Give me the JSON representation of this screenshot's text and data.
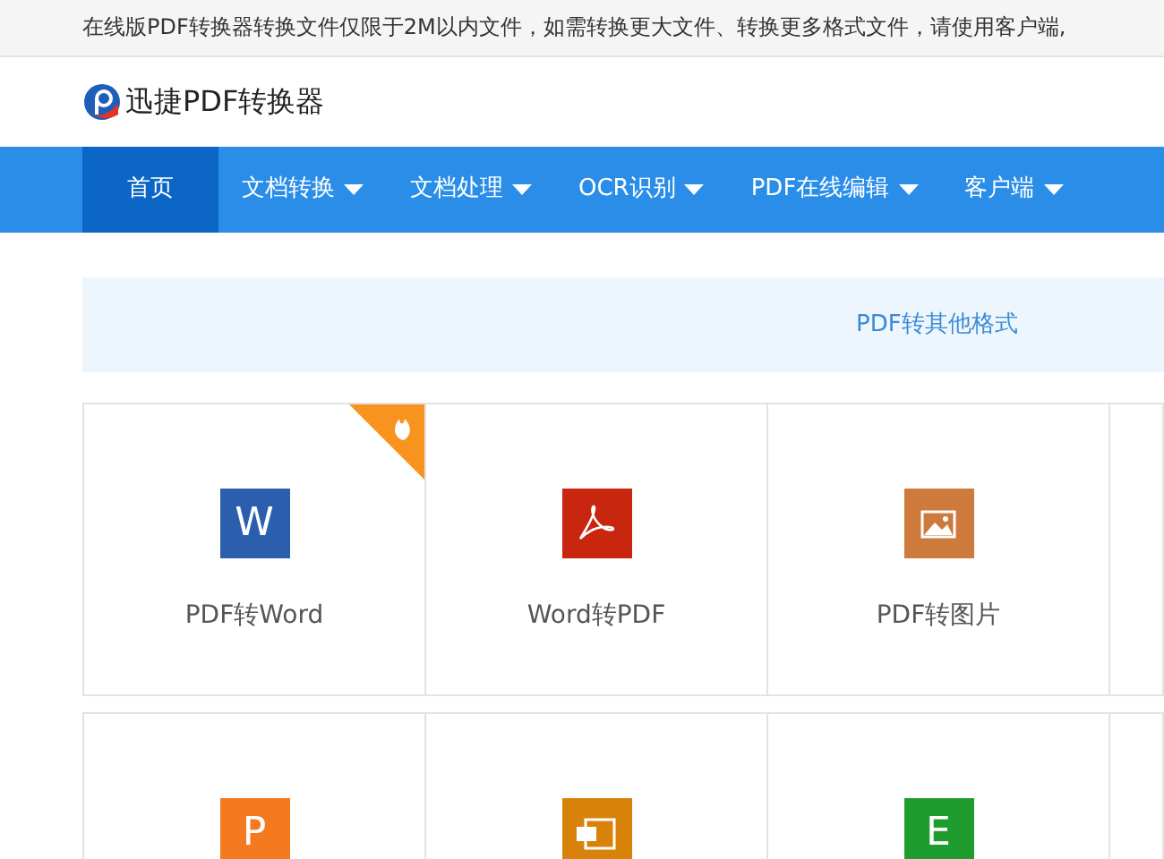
{
  "notice": "在线版PDF转换器转换文件仅限于2M以内文件，如需转换更大文件、转换更多格式文件，请使用客户端,",
  "logo": {
    "text": "迅捷PDF转换器"
  },
  "nav": [
    {
      "label": "首页",
      "selected": true,
      "dropdown": false
    },
    {
      "label": "文档转换",
      "selected": false,
      "dropdown": true
    },
    {
      "label": "文档处理",
      "selected": false,
      "dropdown": true
    },
    {
      "label": "OCR识别",
      "selected": false,
      "dropdown": true
    },
    {
      "label": "PDF在线编辑",
      "selected": false,
      "dropdown": true
    },
    {
      "label": "客户端",
      "selected": false,
      "dropdown": true
    }
  ],
  "section_title": "PDF转其他格式",
  "cards": [
    {
      "kind": "letter",
      "glyph": "W",
      "color": "#2b5fae",
      "label": "PDF转Word",
      "hot": true
    },
    {
      "kind": "acrobat",
      "color": "#c9260f",
      "label": "Word转PDF",
      "hot": false
    },
    {
      "kind": "image",
      "color": "#cd7a3c",
      "label": "PDF转图片",
      "hot": false
    },
    {
      "kind": "empty",
      "hot": false
    },
    {
      "kind": "letter",
      "glyph": "P",
      "color": "#f4791f",
      "hot": false
    },
    {
      "kind": "pdfdoc",
      "color": "#d9820a",
      "hot": false
    },
    {
      "kind": "letter",
      "glyph": "E",
      "color": "#1e9d2e",
      "hot": false
    },
    {
      "kind": "empty",
      "hot": false
    }
  ]
}
